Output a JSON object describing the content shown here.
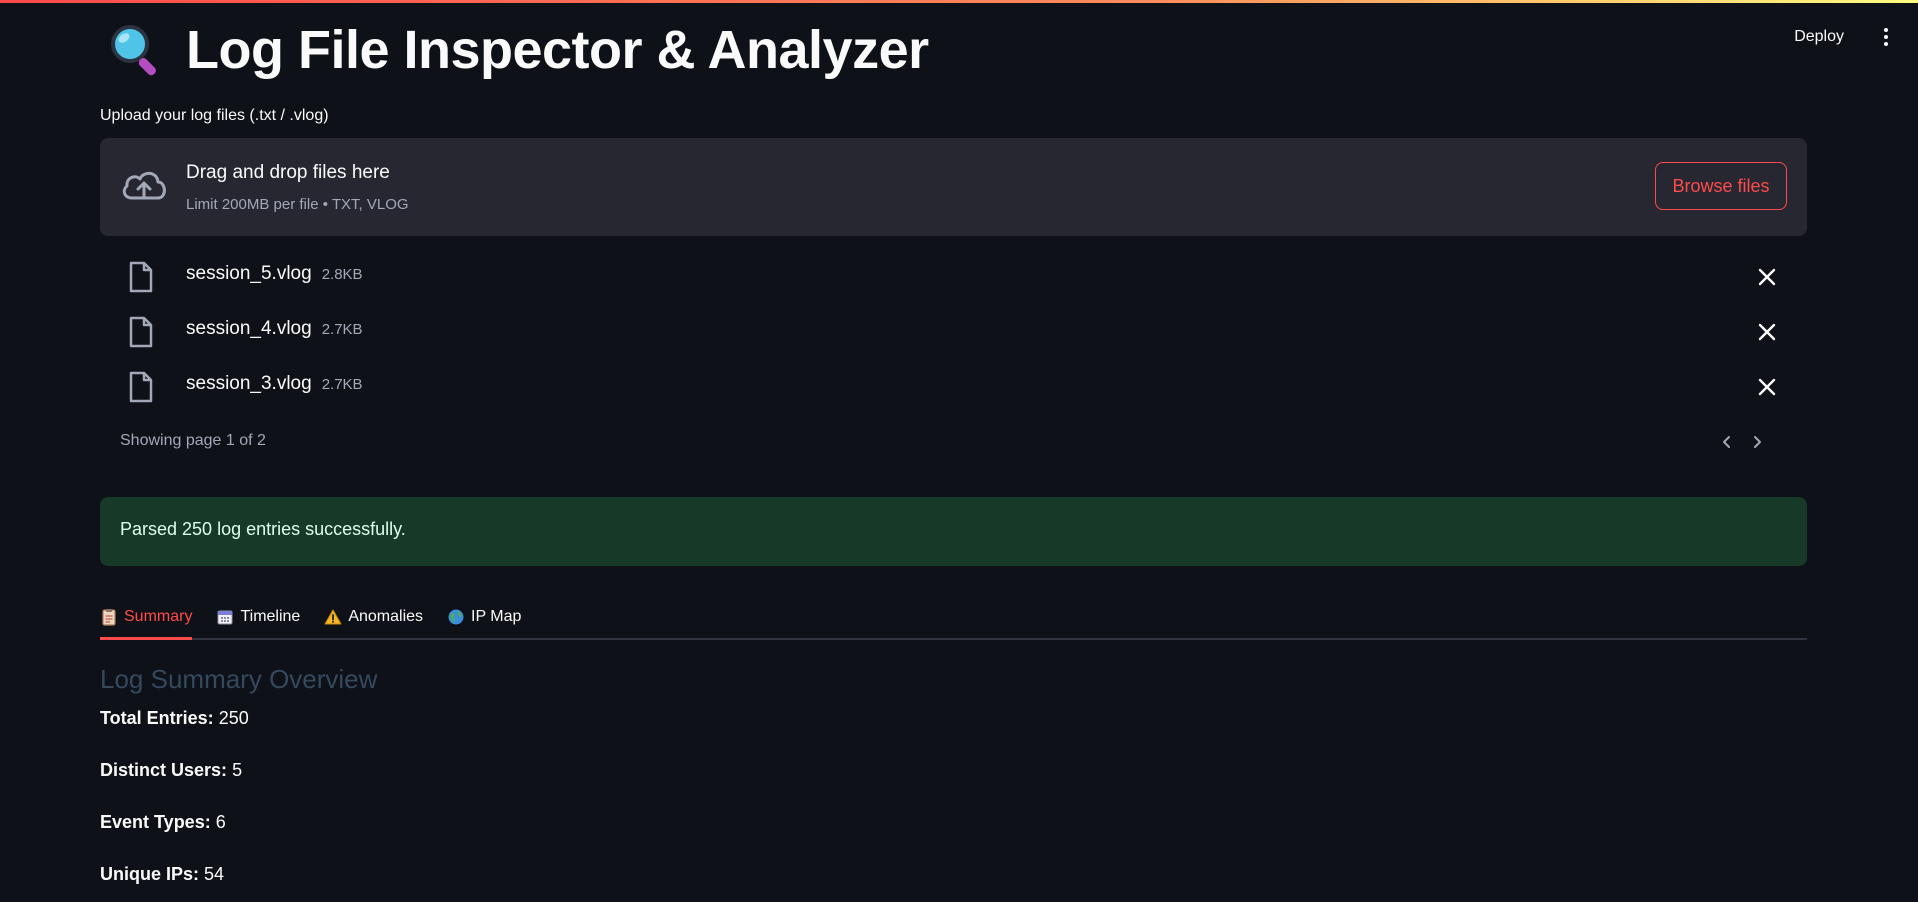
{
  "header": {
    "title": "Log File Inspector & Analyzer",
    "deploy_label": "Deploy"
  },
  "uploader": {
    "label": "Upload your log files (.txt / .vlog)",
    "drop_title": "Drag and drop files here",
    "drop_subtitle": "Limit 200MB per file • TXT, VLOG",
    "browse_label": "Browse files"
  },
  "files": [
    {
      "name": "session_5.vlog",
      "size": "2.8KB"
    },
    {
      "name": "session_4.vlog",
      "size": "2.7KB"
    },
    {
      "name": "session_3.vlog",
      "size": "2.7KB"
    }
  ],
  "pager": {
    "text": "Showing page 1 of 2"
  },
  "status": {
    "success_message": "Parsed 250 log entries successfully."
  },
  "tabs": [
    {
      "label": "Summary",
      "icon": "clipboard-icon",
      "active": true
    },
    {
      "label": "Timeline",
      "icon": "calendar-icon",
      "active": false
    },
    {
      "label": "Anomalies",
      "icon": "warning-icon",
      "active": false
    },
    {
      "label": "IP Map",
      "icon": "globe-icon",
      "active": false
    }
  ],
  "summary": {
    "heading": "Log Summary Overview",
    "stats": [
      {
        "label": "Total Entries:",
        "value": "250"
      },
      {
        "label": "Distinct Users:",
        "value": "5"
      },
      {
        "label": "Event Types:",
        "value": "6"
      },
      {
        "label": "Unique IPs:",
        "value": "54"
      }
    ]
  },
  "colors": {
    "background": "#0e1117",
    "accent": "#ff4b4b",
    "success_bg": "#173928",
    "dropzone_bg": "#262730"
  }
}
